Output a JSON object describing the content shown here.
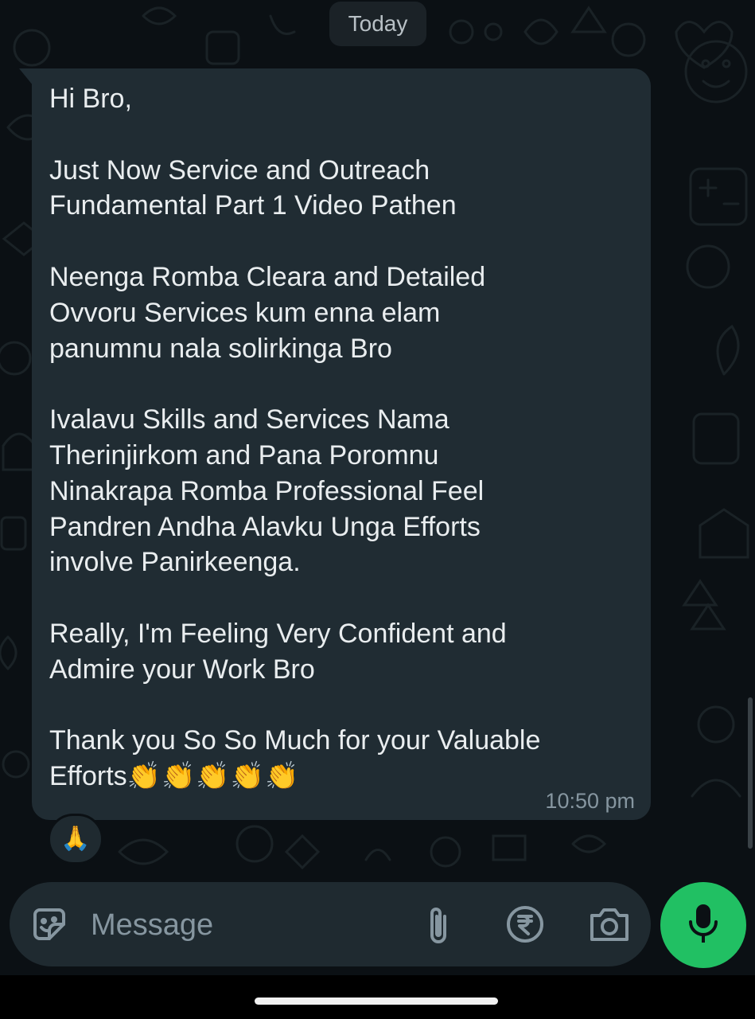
{
  "chat": {
    "date_divider": "Today",
    "message": {
      "text": "Hi Bro,\n\nJust Now Service and Outreach\nFundamental Part 1 Video Pathen\n\nNeenga Romba Cleara and Detailed\nOvvoru Services kum enna elam\npanumnu nala solirkinga Bro\n\nIvalavu Skills and Services Nama\nTherinjirkom and Pana Poromnu\nNinakrapa Romba Professional Feel\nPandren Andha Alavku Unga Efforts\ninvolve Panirkeenga.\n\nReally, I'm Feeling Very Confident and\nAdmire your Work Bro\n\nThank you So So Much for your Valuable\nEfforts",
      "trailing_emoji": "👏👏👏👏👏",
      "time": "10:50 pm",
      "reaction": "🙏"
    }
  },
  "composer": {
    "placeholder": "Message",
    "icons": {
      "emoji": "sticker-emoji-icon",
      "attach": "paperclip-icon",
      "payment": "rupee-icon",
      "camera": "camera-icon",
      "mic": "microphone-icon"
    }
  },
  "colors": {
    "background": "#0b1014",
    "bubble": "#202c33",
    "text": "#e9edef",
    "muted": "#8696a0",
    "accent": "#21c063"
  }
}
